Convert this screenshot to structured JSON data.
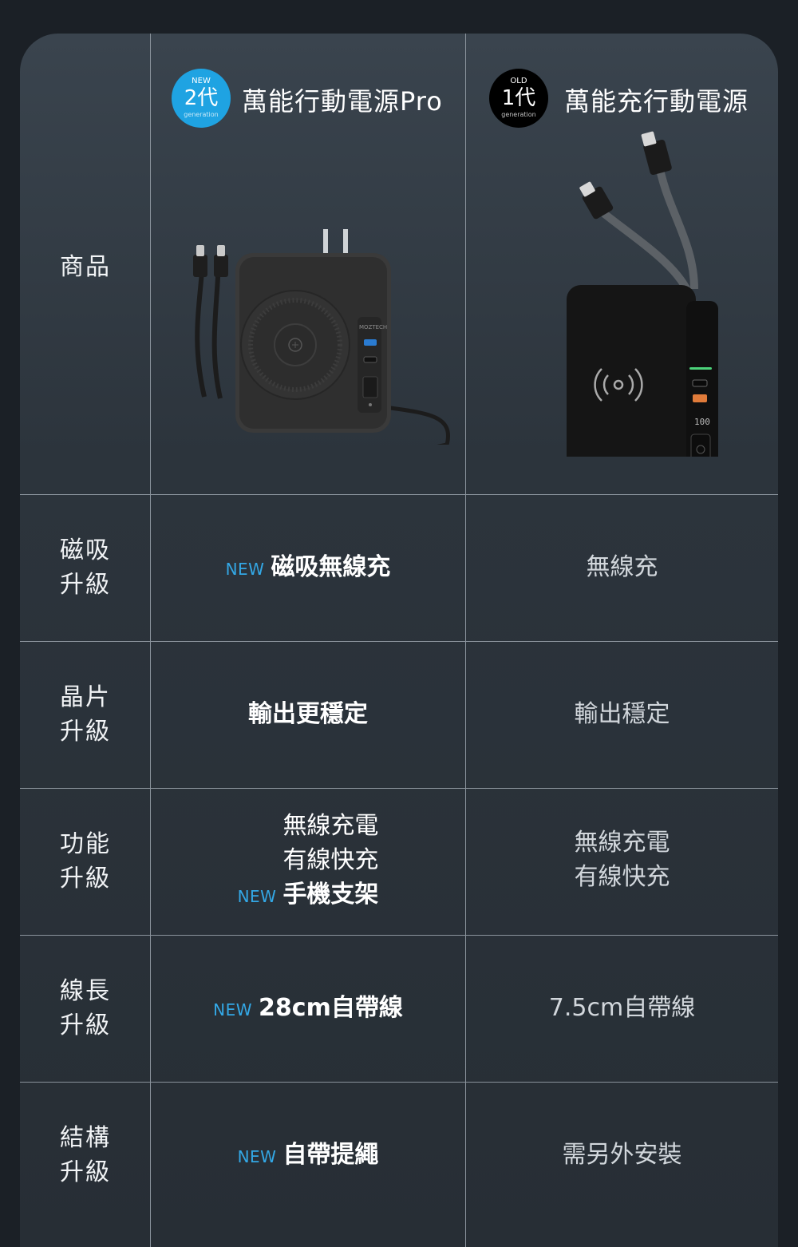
{
  "header": {
    "new_badge": {
      "tag": "NEW",
      "generation": "2代",
      "sub": "generation"
    },
    "new_title": "萬能行動電源Pro",
    "old_badge": {
      "tag": "OLD",
      "generation": "1代",
      "sub": "generation"
    },
    "old_title": "萬能充行動電源"
  },
  "colors": {
    "new_badge": "#1fa3e2",
    "old_badge": "#000000",
    "new_tag": "#33a8e6",
    "panel": "#2c343c"
  },
  "rows": {
    "product": {
      "label": "商品",
      "new_logo": "MOZTECH",
      "old_display": "100"
    },
    "magnetic": {
      "label_1": "磁吸",
      "label_2": "升級",
      "new_tag": "NEW",
      "new_value": "磁吸無線充",
      "old_value": "無線充"
    },
    "chip": {
      "label_1": "晶片",
      "label_2": "升級",
      "new_value": "輸出更穩定",
      "old_value": "輸出穩定"
    },
    "function": {
      "label_1": "功能",
      "label_2": "升級",
      "new_line1": "無線充電",
      "new_line2": "有線快充",
      "new_tag": "NEW",
      "new_line3": "手機支架",
      "old_line1": "無線充電",
      "old_line2": "有線快充"
    },
    "cable": {
      "label_1": "線長",
      "label_2": "升級",
      "new_tag": "NEW",
      "new_value": "28cm自帶線",
      "old_value": "7.5cm自帶線"
    },
    "structure": {
      "label_1": "結構",
      "label_2": "升級",
      "new_tag": "NEW",
      "new_value": "自帶提繩",
      "old_value": "需另外安裝"
    }
  }
}
